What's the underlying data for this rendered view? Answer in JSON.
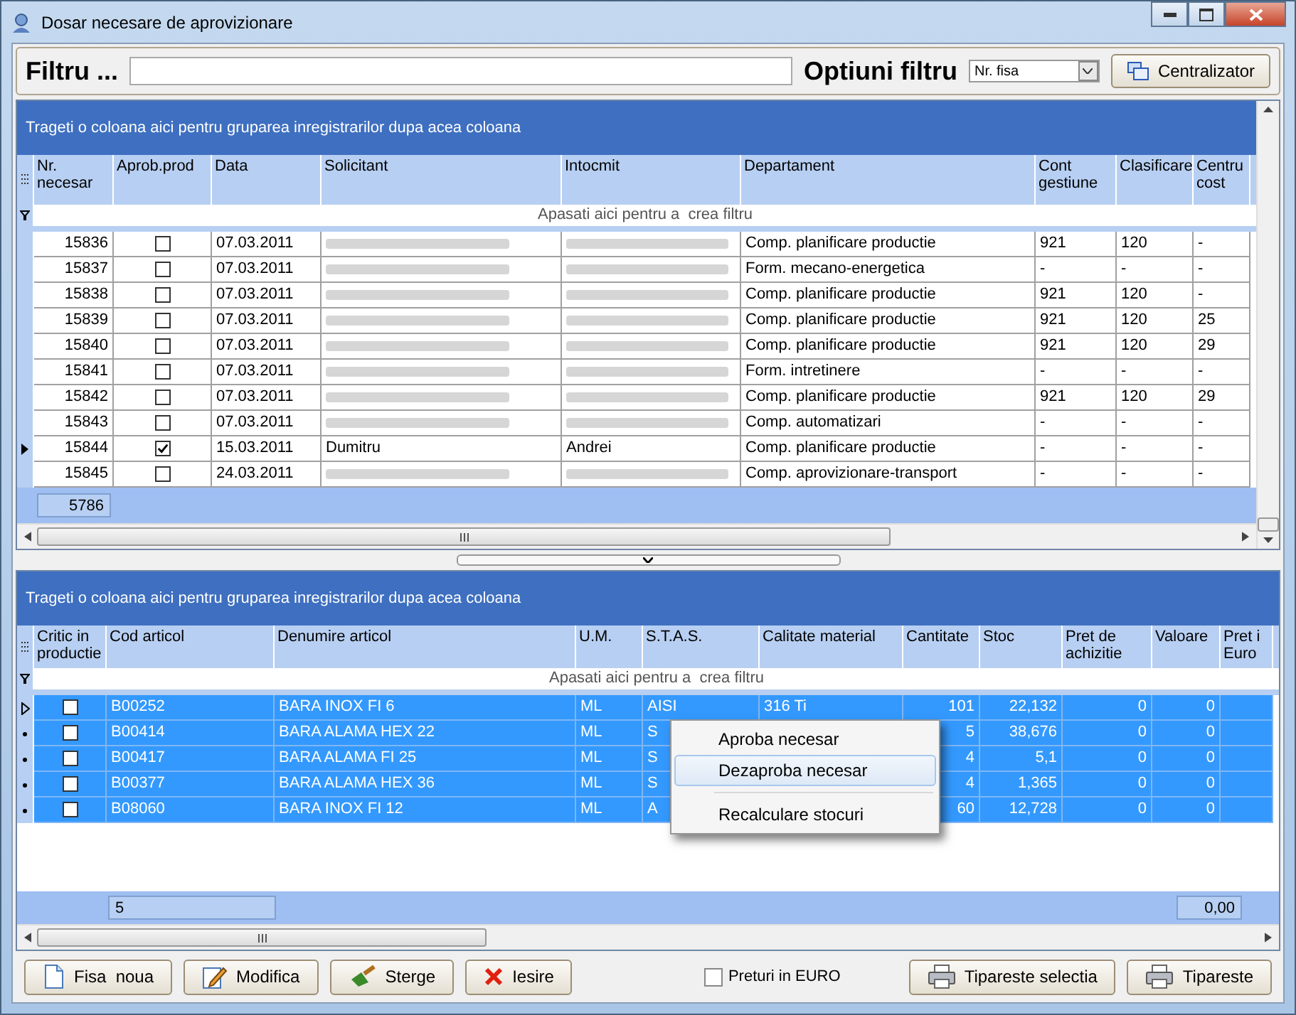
{
  "window": {
    "title": "Dosar necesare de aprovizionare"
  },
  "filter_bar": {
    "label": "Filtru ...",
    "options_label": "Optiuni filtru",
    "option_value": "Nr. fisa",
    "centralizator_button": "Centralizator"
  },
  "upper_grid": {
    "group_hint": "Trageti o coloana aici pentru gruparea inregistrarilor dupa acea coloana",
    "columns": [
      "Nr.\nnecesar",
      "Aprob.prod",
      "Data",
      "Solicitant",
      "Intocmit",
      "Departament",
      "Cont\ngestiune",
      "Clasificare",
      "Centru\ncost"
    ],
    "filter_hint": "Apasati aici pentru a  crea filtru",
    "rows": [
      {
        "nr": "15836",
        "approved": false,
        "date": "07.03.2011",
        "redacted": true,
        "departament": "Comp. planificare productie",
        "cont": "921",
        "clasificare": "120",
        "centru": "-",
        "current": false
      },
      {
        "nr": "15837",
        "approved": false,
        "date": "07.03.2011",
        "redacted": true,
        "departament": "Form. mecano-energetica",
        "cont": "-",
        "clasificare": "-",
        "centru": "-",
        "current": false
      },
      {
        "nr": "15838",
        "approved": false,
        "date": "07.03.2011",
        "redacted": true,
        "departament": "Comp. planificare productie",
        "cont": "921",
        "clasificare": "120",
        "centru": "-",
        "current": false
      },
      {
        "nr": "15839",
        "approved": false,
        "date": "07.03.2011",
        "redacted": true,
        "departament": "Comp. planificare productie",
        "cont": "921",
        "clasificare": "120",
        "centru": "25",
        "current": false
      },
      {
        "nr": "15840",
        "approved": false,
        "date": "07.03.2011",
        "redacted": true,
        "departament": "Comp. planificare productie",
        "cont": "921",
        "clasificare": "120",
        "centru": "29",
        "current": false
      },
      {
        "nr": "15841",
        "approved": false,
        "date": "07.03.2011",
        "redacted": true,
        "departament": "Form. intretinere",
        "cont": "-",
        "clasificare": "-",
        "centru": "-",
        "current": false
      },
      {
        "nr": "15842",
        "approved": false,
        "date": "07.03.2011",
        "redacted": true,
        "departament": "Comp. planificare productie",
        "cont": "921",
        "clasificare": "120",
        "centru": "29",
        "current": false
      },
      {
        "nr": "15843",
        "approved": false,
        "date": "07.03.2011",
        "redacted": true,
        "departament": "Comp. automatizari",
        "cont": "-",
        "clasificare": "-",
        "centru": "-",
        "current": false
      },
      {
        "nr": "15844",
        "approved": true,
        "date": "15.03.2011",
        "redacted": false,
        "solicitant": "Dumitru",
        "intocmit": "Andrei",
        "departament": "Comp. planificare productie",
        "cont": "-",
        "clasificare": "-",
        "centru": "-",
        "current": true
      },
      {
        "nr": "15845",
        "approved": false,
        "date": "24.03.2011",
        "redacted": true,
        "departament": "Comp. aprovizionare-transport",
        "cont": "-",
        "clasificare": "-",
        "centru": "-",
        "current": false
      }
    ],
    "footer_count": "5786"
  },
  "lower_grid": {
    "group_hint": "Trageti o coloana aici pentru gruparea inregistrarilor dupa acea coloana",
    "columns": [
      "Critic in\nproductie",
      "Cod articol",
      "Denumire articol",
      "U.M.",
      "S.T.A.S.",
      "Calitate material",
      "Cantitate",
      "Stoc",
      "Pret de\nachizitie",
      "Valoare",
      "Pret i\nEuro"
    ],
    "filter_hint": "Apasati aici pentru a  crea filtru",
    "rows": [
      {
        "critic": false,
        "cod": "B00252",
        "denumire": "BARA INOX FI 6",
        "um": "ML",
        "stas": "AISI",
        "calitate": "316 Ti",
        "cantitate": "101",
        "stoc": "22,132",
        "pret": "0",
        "valoare": "0",
        "selected": true,
        "current": true
      },
      {
        "critic": false,
        "cod": "B00414",
        "denumire": "BARA ALAMA HEX 22",
        "um": "ML",
        "stas": "S",
        "cantitate": "5",
        "stoc": "38,676",
        "pret": "0",
        "valoare": "0",
        "selected": true,
        "current": false
      },
      {
        "critic": false,
        "cod": "B00417",
        "denumire": "BARA ALAMA FI 25",
        "um": "ML",
        "stas": "S",
        "cantitate": "4",
        "stoc": "5,1",
        "pret": "0",
        "valoare": "0",
        "selected": true,
        "current": false
      },
      {
        "critic": false,
        "cod": "B00377",
        "denumire": "BARA ALAMA HEX 36",
        "um": "ML",
        "stas": "S",
        "cantitate": "4",
        "stoc": "1,365",
        "pret": "0",
        "valoare": "0",
        "selected": true,
        "current": false
      },
      {
        "critic": false,
        "cod": "B08060",
        "denumire": "BARA INOX FI 12",
        "um": "ML",
        "stas": "A",
        "cantitate": "60",
        "stoc": "12,728",
        "pret": "0",
        "valoare": "0",
        "selected": true,
        "current": false
      }
    ],
    "footer_count": "5",
    "footer_total": "0,00"
  },
  "context_menu": {
    "items": [
      {
        "label": "Aproba necesar",
        "kind": "item",
        "selected": false
      },
      {
        "label": "Dezaproba necesar",
        "kind": "item",
        "selected": true
      },
      {
        "kind": "separator"
      },
      {
        "label": "Recalculare stocuri",
        "kind": "item",
        "selected": false
      }
    ]
  },
  "buttons": [
    {
      "label": "Fisa  noua",
      "kind": "new"
    },
    {
      "label": "Modifica",
      "kind": "edit"
    },
    {
      "label": "Sterge",
      "kind": "delete"
    },
    {
      "label": "Iesire",
      "kind": "exit"
    }
  ],
  "euro_checkbox": {
    "label": "Preturi in EURO",
    "checked": false
  },
  "print_buttons": [
    {
      "label": "Tipareste selectia",
      "kind": "print"
    },
    {
      "label": "Tipareste",
      "kind": "print"
    }
  ]
}
